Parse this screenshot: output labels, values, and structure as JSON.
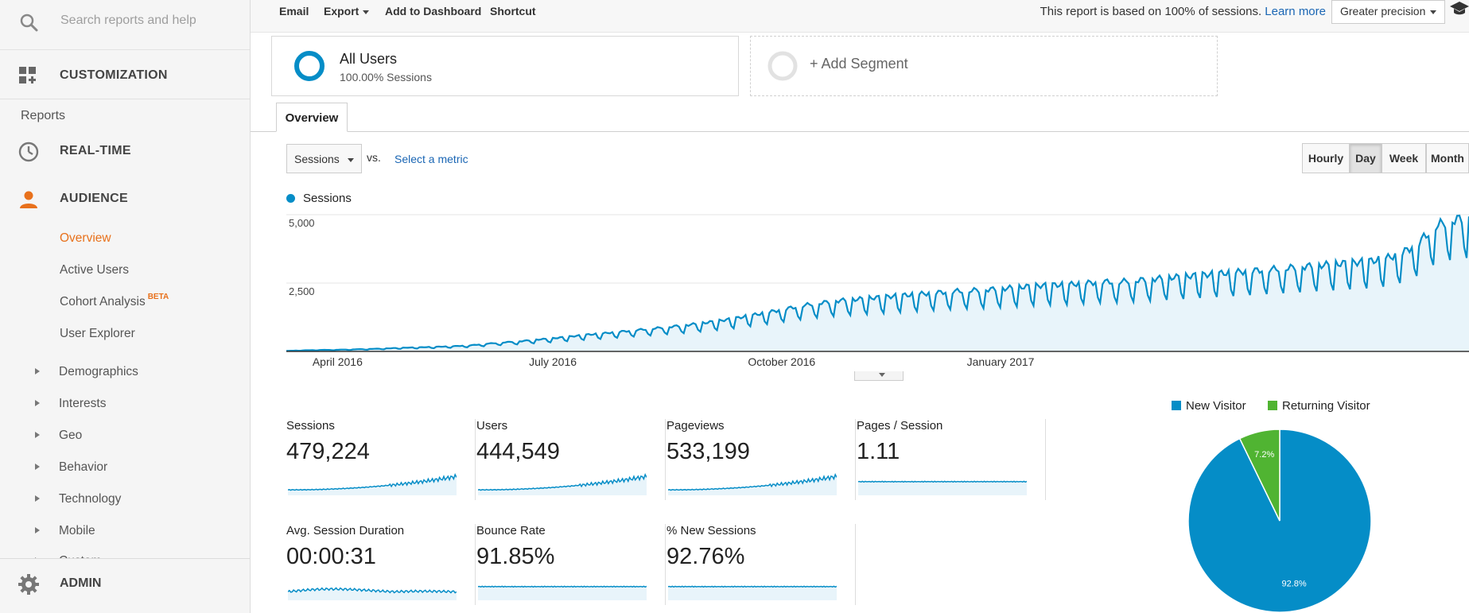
{
  "sidebar": {
    "search_placeholder": "Search reports and help",
    "customization": "CUSTOMIZATION",
    "reports_label": "Reports",
    "realtime": "REAL-TIME",
    "audience": "AUDIENCE",
    "audience_items": [
      "Overview",
      "Active Users",
      "Cohort Analysis",
      "User Explorer"
    ],
    "beta_badge": "BETA",
    "tree_items": [
      "Demographics",
      "Interests",
      "Geo",
      "Behavior",
      "Technology",
      "Mobile",
      "Custom"
    ],
    "admin": "ADMIN"
  },
  "toolbar": {
    "email": "Email",
    "export": "Export",
    "add_to_dashboard": "Add to Dashboard",
    "shortcut": "Shortcut",
    "sampling_note": "This report is based on 100% of sessions.",
    "learn_more": "Learn more",
    "precision": "Greater precision"
  },
  "segments": {
    "all_users_title": "All Users",
    "all_users_sub": "100.00% Sessions",
    "add_segment": "+ Add Segment"
  },
  "tab": {
    "overview": "Overview"
  },
  "controls": {
    "metric": "Sessions",
    "vs": "vs.",
    "select_metric": "Select a metric",
    "periods": [
      "Hourly",
      "Day",
      "Week",
      "Month"
    ],
    "active_period": "Day"
  },
  "colors": {
    "series": "#058dc7",
    "fill": "#e8f4fa",
    "new_visitor": "#058dc7",
    "returning_visitor": "#50b432",
    "active_nav": "#e8711c",
    "link": "#1a66b4"
  },
  "chart_data": [
    {
      "type": "area",
      "legend": [
        "Sessions"
      ],
      "series": [
        {
          "name": "Sessions",
          "anchors": [
            [
              0,
              20
            ],
            [
              7,
              40
            ],
            [
              14,
              55
            ],
            [
              21,
              60
            ],
            [
              28,
              75
            ],
            [
              35,
              90
            ],
            [
              42,
              110
            ],
            [
              49,
              135
            ],
            [
              56,
              150
            ],
            [
              63,
              170
            ],
            [
              70,
              190
            ],
            [
              77,
              220
            ],
            [
              84,
              280
            ],
            [
              91,
              330
            ],
            [
              98,
              370
            ],
            [
              105,
              430
            ],
            [
              112,
              480
            ],
            [
              119,
              540
            ],
            [
              126,
              610
            ],
            [
              133,
              660
            ],
            [
              140,
              720
            ],
            [
              147,
              780
            ],
            [
              154,
              840
            ],
            [
              161,
              900
            ],
            [
              168,
              960
            ],
            [
              175,
              1040
            ],
            [
              182,
              1120
            ],
            [
              189,
              1220
            ],
            [
              196,
              1330
            ],
            [
              203,
              1440
            ],
            [
              210,
              1560
            ],
            [
              217,
              1680
            ],
            [
              224,
              1770
            ],
            [
              231,
              1850
            ],
            [
              238,
              1900
            ],
            [
              245,
              1950
            ],
            [
              252,
              2000
            ],
            [
              259,
              2050
            ],
            [
              266,
              2100
            ],
            [
              273,
              2150
            ],
            [
              280,
              2200
            ],
            [
              287,
              2230
            ],
            [
              294,
              2260
            ],
            [
              301,
              2300
            ],
            [
              308,
              2350
            ],
            [
              315,
              2400
            ],
            [
              322,
              2430
            ],
            [
              329,
              2450
            ],
            [
              336,
              2500
            ],
            [
              343,
              2550
            ],
            [
              350,
              2550
            ],
            [
              357,
              2600
            ],
            [
              364,
              2650
            ],
            [
              371,
              2700
            ],
            [
              378,
              2750
            ],
            [
              385,
              2800
            ],
            [
              392,
              2850
            ],
            [
              399,
              2900
            ],
            [
              406,
              2950
            ],
            [
              413,
              3000
            ],
            [
              420,
              3050
            ],
            [
              427,
              3100
            ],
            [
              434,
              3150
            ],
            [
              441,
              3200
            ],
            [
              448,
              3250
            ],
            [
              455,
              3300
            ],
            [
              462,
              3400
            ],
            [
              469,
              3600
            ],
            [
              476,
              4000
            ],
            [
              483,
              4600
            ],
            [
              490,
              4800
            ],
            [
              497,
              4900
            ]
          ]
        }
      ],
      "x_range": [
        0,
        497
      ],
      "x_tick_positions": [
        21,
        112,
        204,
        296
      ],
      "xtick_labels": [
        "April 2016",
        "July 2016",
        "October 2016",
        "January 2017"
      ],
      "yticks": [
        2500,
        5000
      ],
      "ytick_labels": [
        "2,500",
        "5,000"
      ],
      "ylim": [
        0,
        5000
      ],
      "grid": true
    },
    {
      "type": "pie",
      "legend": [
        "New Visitor",
        "Returning Visitor"
      ],
      "labels": [
        "New Visitor",
        "Returning Visitor"
      ],
      "values": [
        92.8,
        7.2
      ],
      "value_labels": [
        "92.8%",
        "7.2%"
      ]
    }
  ],
  "kpis": [
    {
      "label": "Sessions",
      "value": "479,224",
      "trend": "rising"
    },
    {
      "label": "Users",
      "value": "444,549",
      "trend": "rising"
    },
    {
      "label": "Pageviews",
      "value": "533,199",
      "trend": "rising"
    },
    {
      "label": "Pages / Session",
      "value": "1.11",
      "trend": "flat"
    },
    {
      "label": "Avg. Session Duration",
      "value": "00:00:31",
      "trend": "noisy"
    },
    {
      "label": "Bounce Rate",
      "value": "91.85%",
      "trend": "flat"
    },
    {
      "label": "% New Sessions",
      "value": "92.76%",
      "trend": "flat"
    }
  ]
}
